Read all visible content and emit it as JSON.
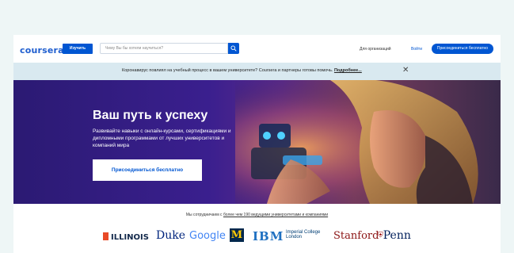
{
  "header": {
    "logo": "coursera",
    "explore_label": "Изучить",
    "search_placeholder": "Чему Вы бы хотели научиться?",
    "org_link": "Для организаций",
    "login_link": "Войти",
    "join_button": "Присоединиться бесплатно"
  },
  "banner": {
    "text": "Коронавирус повлиял на учебный процесс в вашем университете? Coursera и партнеры готовы помочь.",
    "link": "Подробнее...",
    "close": "✕"
  },
  "hero": {
    "title": "Ваш путь к успеху",
    "subtitle": "Развивайте навыки с онлайн-курсами, сертификациями и дипломными программами от лучших университетов и компаний мира",
    "cta": "Присоединиться бесплатно"
  },
  "partners": {
    "prefix": "Мы сотрудничаем с ",
    "link": "более чем 190 ведущими университетами и компаниями",
    "logos": {
      "illinois": "ILLINOIS",
      "duke": "Duke",
      "google": "Google",
      "michigan": "M",
      "ibm": "IBM",
      "imperial_1": "Imperial College",
      "imperial_2": "London",
      "stanford": "Stanford",
      "penn": "Penn"
    }
  },
  "colors": {
    "brand": "#0056d2",
    "banner_bg": "#d9e9f0"
  }
}
